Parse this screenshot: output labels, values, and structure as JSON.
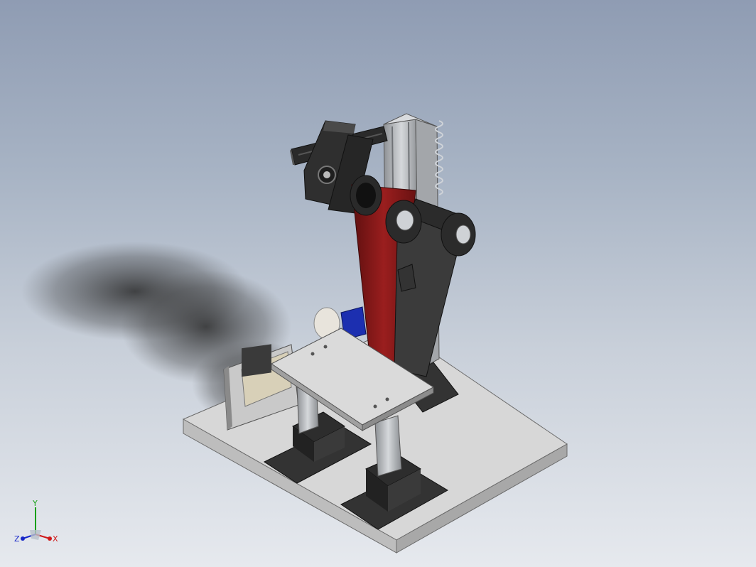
{
  "colors": {
    "background_top": "#8f9cb3",
    "background_bottom": "#e6e9ee",
    "base_plate": "#cfcfcf",
    "aluminum": "#b9bcbf",
    "dark_part": "#2e2e2e",
    "red_arm": "#8b1a1a",
    "table_top": "#d6d6d6",
    "motor_blue": "#1c2fb0",
    "axis_x": "#d01818",
    "axis_y": "#18a018",
    "axis_z": "#1828c8"
  },
  "triad": {
    "x_label": "X",
    "y_label": "Y",
    "z_label": "Z"
  }
}
